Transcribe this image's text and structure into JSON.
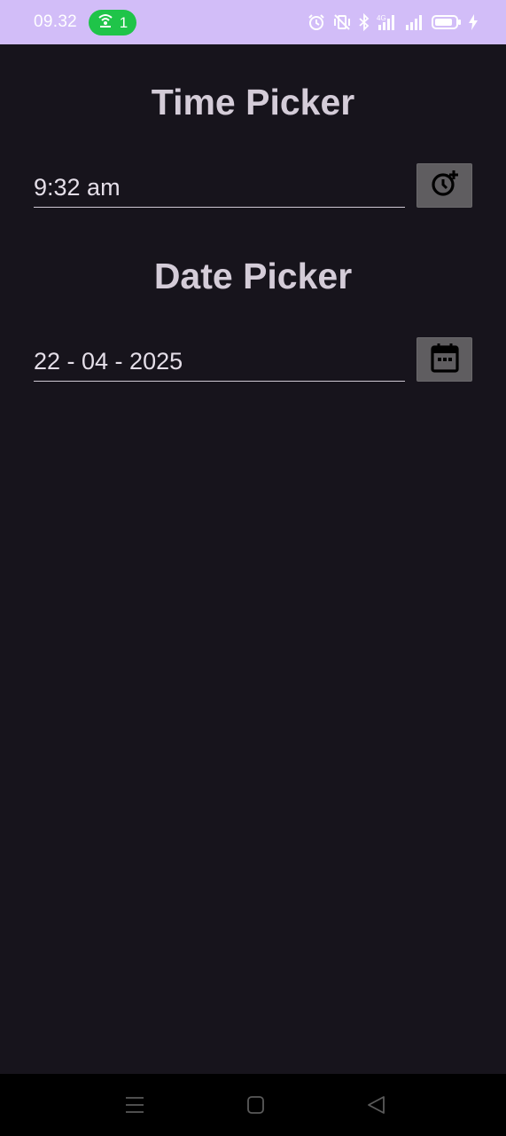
{
  "status_bar": {
    "time": "09.32",
    "hotspot_count": "1",
    "background_color": "#d2bdf8",
    "hotspot_color": "#1fc449",
    "icons": [
      "hotspot-icon",
      "alarm-icon",
      "vibrate-off-icon",
      "bluetooth-icon",
      "signal-4g-icon",
      "signal-icon",
      "battery-icon",
      "charging-icon"
    ]
  },
  "time_picker": {
    "heading": "Time Picker",
    "value": "9:32 am",
    "button_icon": "add-alarm-icon"
  },
  "date_picker": {
    "heading": "Date Picker",
    "value": "22 - 04 - 2025",
    "button_icon": "calendar-icon"
  },
  "nav_bar": {
    "icons": [
      "menu-icon",
      "home-icon",
      "back-icon"
    ]
  }
}
